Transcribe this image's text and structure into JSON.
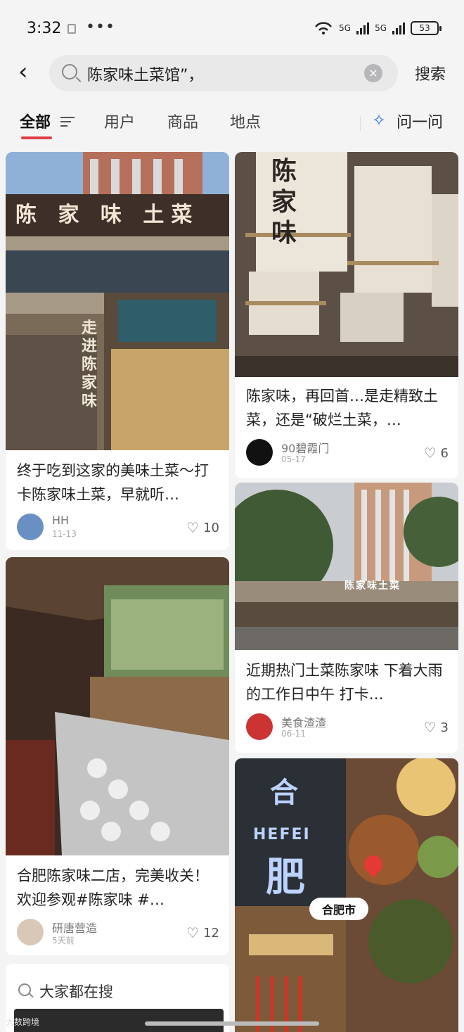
{
  "status_bar": {
    "time": "3:32",
    "dots": "•••",
    "signal1": "5G",
    "signal2": "5G",
    "battery": "53"
  },
  "search": {
    "query": "陈家味土菜馆”，",
    "clear": "×",
    "submit": "搜索",
    "back": "‹"
  },
  "tabs": [
    {
      "label": "全部"
    },
    {
      "label": "用户"
    },
    {
      "label": "商品"
    },
    {
      "label": "地点"
    }
  ],
  "ask": {
    "label": "问一问"
  },
  "cards": [
    {
      "title": "终于吃到这家的美味土菜～打卡陈家味土菜，早就听…",
      "user": "HH",
      "date": "11-13",
      "likes": "10",
      "sign_text": "陈 家 味 土菜",
      "side_text": "走进陈家味"
    },
    {
      "title": "陈家味，再回首…是走精致土菜，还是“破烂土菜，…",
      "user": "90碧霞门",
      "date": "05-17",
      "likes": "6",
      "lantern_text": "陈家味"
    },
    {
      "title": "近期热门土菜陈家味 下着大雨的工作日中午 打卡…",
      "user": "美食渣渣",
      "date": "06-11",
      "likes": "3",
      "sign_text": "陈家味土菜"
    },
    {
      "title": "合肥陈家味二店，完美收关！欢迎参观#陈家味 #…",
      "user": "研唐营造",
      "date": "5天前",
      "likes": "12"
    },
    {
      "city_top": "合",
      "city_latin": "HEFEI",
      "city_bottom": "肥",
      "pin_label": "合肥市"
    }
  ],
  "hot": {
    "title": "大家都在搜"
  },
  "watermark": "大数跨境",
  "colors": {
    "accent": "#e03b46",
    "ask_blue": "#3a7be8",
    "background": "#f4f4f4"
  }
}
